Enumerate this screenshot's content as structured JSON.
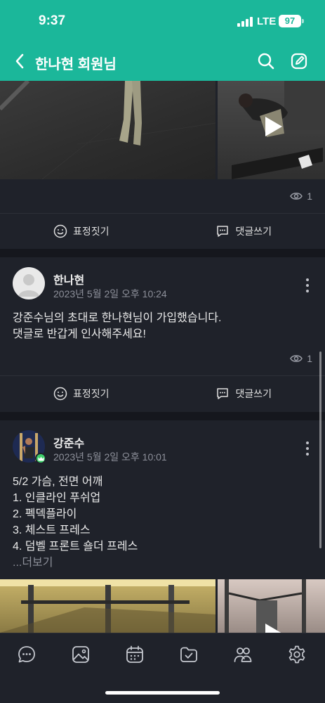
{
  "status_bar": {
    "time": "9:37",
    "network": "LTE",
    "battery": "97"
  },
  "nav": {
    "title": "한나현 회원님",
    "back_icon": "chevron-left-icon",
    "search_icon": "search-icon",
    "compose_icon": "compose-icon"
  },
  "posts": [
    {
      "views": "1",
      "actions": {
        "react": "표정짓기",
        "comment": "댓글쓰기"
      }
    },
    {
      "author": "한나현",
      "date": "2023년 5월 2일 오후 10:24",
      "body_lines": [
        "강준수님의 초대로 한나현님이 가입했습니다.",
        "댓글로 반갑게 인사해주세요!"
      ],
      "views": "1",
      "actions": {
        "react": "표정짓기",
        "comment": "댓글쓰기"
      }
    },
    {
      "author": "강준수",
      "date": "2023년 5월 2일 오후 10:01",
      "body_lines": [
        "5/2 가슴, 전면 어깨",
        "1. 인클라인 푸쉬업",
        "2. 펙덱플라이",
        "3. 체스트 프레스",
        "4. 덤벨 프론트 숄더 프레스"
      ],
      "more_label": "...더보기"
    }
  ],
  "bottom_tabs": [
    "chat-icon",
    "gallery-icon",
    "calendar-icon",
    "folder-check-icon",
    "members-icon",
    "settings-icon"
  ],
  "colors": {
    "accent": "#1bb79a",
    "background": "#1f222a",
    "separator": "#15171d"
  }
}
